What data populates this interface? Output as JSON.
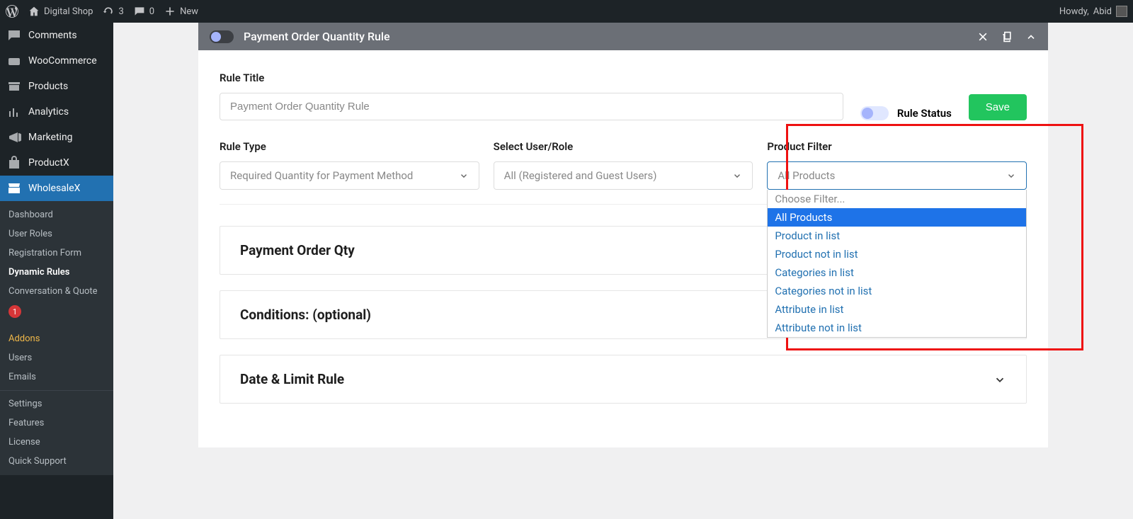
{
  "adminbar": {
    "site_name": "Digital Shop",
    "updates_count": "3",
    "comments_count": "0",
    "new_label": "New",
    "howdy_prefix": "Howdy,",
    "user_name": "Abid"
  },
  "sidebar": {
    "comments": "Comments",
    "woocommerce": "WooCommerce",
    "products": "Products",
    "analytics": "Analytics",
    "marketing": "Marketing",
    "productx": "ProductX",
    "wholesalex": "WholesaleX",
    "submenu": {
      "dashboard": "Dashboard",
      "user_roles": "User Roles",
      "registration_form": "Registration Form",
      "dynamic_rules": "Dynamic Rules",
      "conversation_quote": "Conversation & Quote",
      "conversation_badge": "1",
      "addons": "Addons",
      "users": "Users",
      "emails": "Emails",
      "settings": "Settings",
      "features": "Features",
      "license": "License",
      "quick_support": "Quick Support"
    }
  },
  "rule": {
    "header_title": "Payment Order Quantity Rule",
    "title_label": "Rule Title",
    "title_value": "Payment Order Quantity Rule",
    "status_label": "Rule Status",
    "save_label": "Save",
    "rule_type_label": "Rule Type",
    "rule_type_value": "Required Quantity for Payment Method",
    "user_role_label": "Select User/Role",
    "user_role_value": "All (Registered and Guest Users)",
    "product_filter_label": "Product Filter",
    "product_filter_value": "All Products",
    "product_filter_options": [
      "Choose Filter...",
      "All Products",
      "Product in list",
      "Product not in list",
      "Categories in list",
      "Categories not in list",
      "Attribute in list",
      "Attribute not in list"
    ],
    "accordion1": "Payment Order Qty",
    "accordion2": "Conditions: (optional)",
    "accordion3": "Date & Limit Rule"
  },
  "colors": {
    "highlight": "#e11",
    "primary": "#2271b1",
    "save": "#22c55e"
  }
}
